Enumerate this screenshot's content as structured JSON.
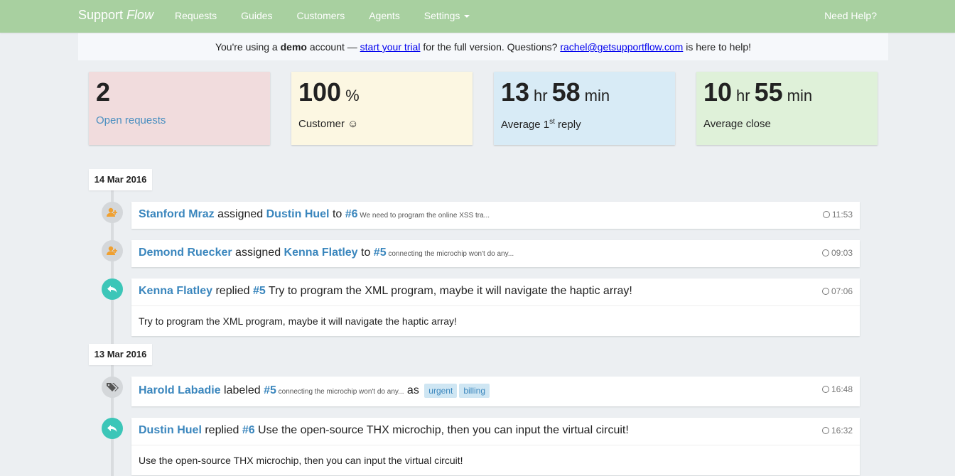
{
  "nav": {
    "brand_main": "Support",
    "brand_italic": "Flow",
    "links": [
      "Requests",
      "Guides",
      "Customers",
      "Agents",
      "Settings"
    ],
    "help": "Need Help?"
  },
  "banner": {
    "prefix": "You're using a ",
    "account_type": "demo",
    "mid": " account — ",
    "trial_link": "start your trial",
    "after_trial": " for the full version. Questions? ",
    "email": "rachel@getsupportflow.com",
    "suffix": " is here to help!"
  },
  "stats": {
    "open": {
      "value": "2",
      "label": "Open requests"
    },
    "satisfaction": {
      "value": "100",
      "unit": "%",
      "label": "Customer ☺"
    },
    "first_reply": {
      "hours": "13",
      "hr": "hr",
      "minutes": "58",
      "min": "min",
      "label": "Average 1",
      "sup": "st",
      "label_end": " reply"
    },
    "close": {
      "hours": "10",
      "hr": "hr",
      "minutes": "55",
      "min": "min",
      "label": "Average close"
    }
  },
  "timeline": {
    "dates": [
      "14 Mar 2016",
      "13 Mar 2016"
    ],
    "entries": [
      {
        "actor": "Stanford Mraz",
        "verb": " assigned ",
        "target": "Dustin Huel",
        "to": " to ",
        "ticket": "#6",
        "snippet": " We need to program the online XSS tra...",
        "time": "11:53"
      },
      {
        "actor": "Demond Ruecker",
        "verb": " assigned ",
        "target": "Kenna Flatley",
        "to": " to ",
        "ticket": "#5",
        "snippet": " connecting the microchip won't do any...",
        "time": "09:03"
      },
      {
        "actor": "Kenna Flatley",
        "verb": " replied ",
        "ticket": "#5",
        "title": " Try to program the XML program, maybe it will navigate the haptic array!",
        "time": "07:06",
        "body": "Try to program the XML program, maybe it will navigate the haptic array!"
      },
      {
        "actor": "Harold Labadie",
        "verb": " labeled ",
        "ticket": "#5",
        "snippet": " connecting the microchip won't do any...",
        "as": " as ",
        "tags": [
          "urgent",
          "billing"
        ],
        "time": "16:48"
      },
      {
        "actor": "Dustin Huel",
        "verb": " replied ",
        "ticket": "#6",
        "title": " Use the open-source THX microchip, then you can input the virtual circuit!",
        "time": "16:32",
        "body": "Use the open-source THX microchip, then you can input the virtual circuit!"
      }
    ]
  },
  "colors": {
    "navbar": "#a8d0a0",
    "link": "#3a86bd",
    "teal": "#3cc6b8",
    "orange": "#f0a030"
  }
}
